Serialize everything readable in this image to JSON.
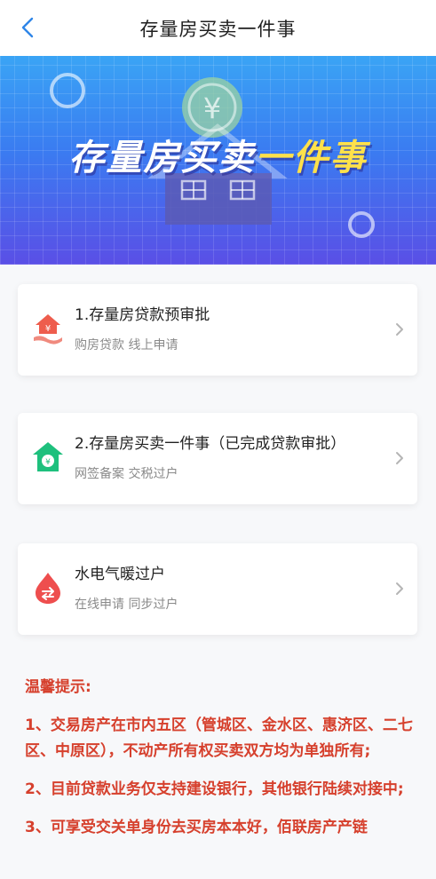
{
  "header": {
    "title": "存量房买卖一件事"
  },
  "banner": {
    "title_white": "存量房买卖",
    "title_yellow": "一件事"
  },
  "cards": [
    {
      "title": "1.存量房贷款预审批",
      "subtitle": "购房贷款 线上申请",
      "icon": "loan-house-icon",
      "color": "#ee5d4d"
    },
    {
      "title": "2.存量房买卖一件事（已完成贷款审批）",
      "subtitle": "网签备案 交税过户",
      "icon": "green-house-icon",
      "color": "#1ec07d"
    },
    {
      "title": "水电气暖过户",
      "subtitle": "在线申请 同步过户",
      "icon": "utility-flame-icon",
      "color": "#ee4e4e"
    }
  ],
  "tips": {
    "heading": "温馨提示:",
    "items": [
      "1、交易房产在市内五区（管城区、金水区、惠济区、二七区、中原区），不动产所有权买卖双方均为单独所有;",
      "2、目前贷款业务仅支持建设银行，其他银行陆续对接中;",
      "3、可享受交关单身份去买房本本好，佰联房产产链"
    ]
  },
  "colors": {
    "accent_blue": "#3a7cf1",
    "tip_red": "#d6402d"
  }
}
